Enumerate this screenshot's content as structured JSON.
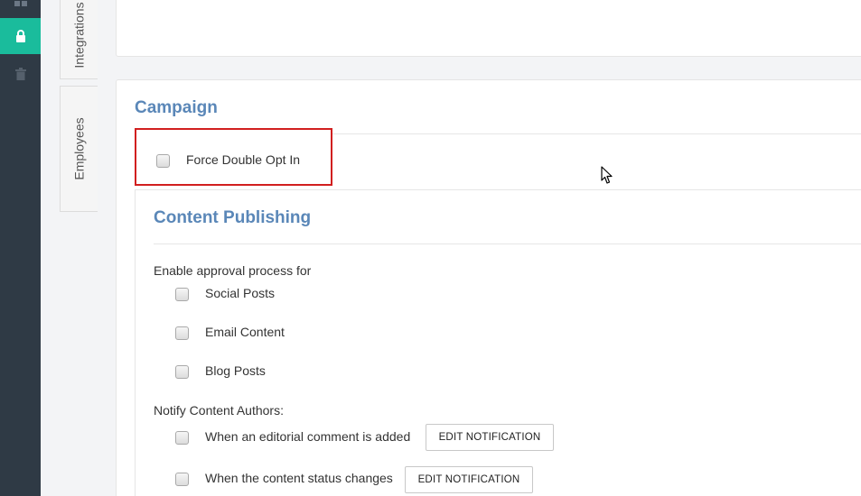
{
  "sidebar": {
    "icons": [
      "dashboard-icon",
      "lock-icon",
      "trash-icon"
    ],
    "active_color": "#1abc9c"
  },
  "tabs": {
    "integrations": "Integrations",
    "employees": "Employees"
  },
  "campaign": {
    "title": "Campaign",
    "force_double_opt_in": "Force Double Opt In"
  },
  "content_publishing": {
    "title": "Content Publishing",
    "approval_label": "Enable approval process for",
    "approval_options": [
      "Social Posts",
      "Email Content",
      "Blog Posts"
    ],
    "notify_label": "Notify Content Authors:",
    "notify_options": [
      {
        "label": "When an editorial comment is added",
        "button": "EDIT NOTIFICATION"
      },
      {
        "label": "When the content status changes",
        "button": "EDIT NOTIFICATION"
      }
    ]
  },
  "colors": {
    "heading": "#5a87b8",
    "highlight_border": "#d11f1f",
    "sidebar_bg": "#2f3a45"
  }
}
